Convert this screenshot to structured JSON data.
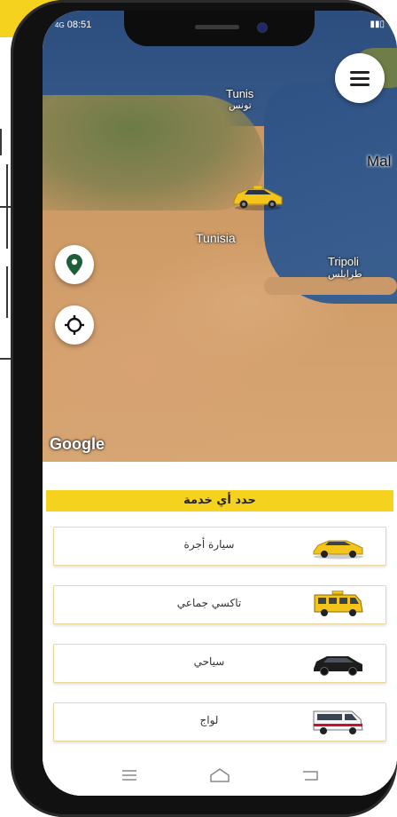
{
  "status_bar": {
    "signal": "4G",
    "time": "08:51"
  },
  "map": {
    "labels": {
      "tunis": "Tunis",
      "tunis_ar": "تونس",
      "malta": "Mal",
      "tunisia": "Tunisia",
      "tripoli": "Tripoli",
      "tripoli_ar": "طرابلس",
      "google": "Google"
    }
  },
  "panel": {
    "title": "حدد أي خدمة",
    "services": [
      {
        "label": "سيارة أجرة",
        "icon": "taxi-car-icon"
      },
      {
        "label": "تاكسي جماعي",
        "icon": "shared-taxi-van-icon"
      },
      {
        "label": "سياحي",
        "icon": "suv-icon"
      },
      {
        "label": "لواج",
        "icon": "louage-van-icon"
      }
    ]
  },
  "colors": {
    "accent": "#f5d21e",
    "pin": "#1e5e3a"
  }
}
